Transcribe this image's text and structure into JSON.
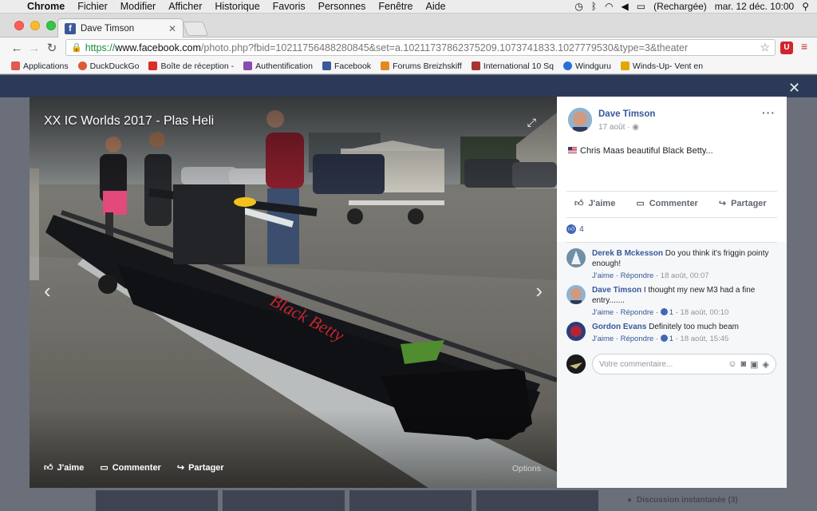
{
  "menubar": {
    "app": "Chrome",
    "items": [
      "Fichier",
      "Modifier",
      "Afficher",
      "Historique",
      "Favoris",
      "Personnes",
      "Fenêtre",
      "Aide"
    ],
    "battery": "(Rechargée)",
    "datetime": "mar. 12 déc.  10:00"
  },
  "browser": {
    "tab_title": "Dave Timson",
    "url_scheme": "https://",
    "url_host": "www.facebook.com",
    "url_path": "/photo.php?fbid=10211756488280845&set=a.10211737862375209.1073741833.1027779530&type=3&theater",
    "bookmarks": [
      {
        "label": "Applications",
        "color": "#d44"
      },
      {
        "label": "DuckDuckGo",
        "color": "#de5833"
      },
      {
        "label": "Boîte de réception -",
        "color": "#d93025"
      },
      {
        "label": "Authentification",
        "color": "#8a4baf"
      },
      {
        "label": "Facebook",
        "color": "#3b5998"
      },
      {
        "label": "Forums Breizhskiff",
        "color": "#e28a20"
      },
      {
        "label": "International 10 Sq",
        "color": "#a33"
      },
      {
        "label": "Windguru",
        "color": "#2a6fd6"
      },
      {
        "label": "Winds-Up- Vent en",
        "color": "#e0a800"
      }
    ]
  },
  "photo": {
    "title": "XX IC Worlds 2017 - Plas Heli",
    "actions": {
      "like": "J'aime",
      "comment": "Commenter",
      "share": "Partager"
    },
    "options": "Options"
  },
  "post": {
    "author": "Dave Timson",
    "date": "17 août",
    "caption": "Chris Maas beautiful Black Betty...",
    "actions": {
      "like": "J'aime",
      "comment": "Commenter",
      "share": "Partager"
    },
    "like_count": "4",
    "comments": [
      {
        "author": "Derek B Mckesson",
        "text": "Do you think it's friggin pointy enough!",
        "like": "J'aime",
        "reply": "Répondre",
        "likes": "",
        "time": "18 août, 00:07"
      },
      {
        "author": "Dave Timson",
        "text": "I thought my new M3 had a fine entry.......",
        "like": "J'aime",
        "reply": "Répondre",
        "likes": "1",
        "time": "18 août, 00:10"
      },
      {
        "author": "Gordon Evans",
        "text": "Definitely too much beam",
        "like": "J'aime",
        "reply": "Répondre",
        "likes": "1",
        "time": "18 août, 15:45"
      }
    ],
    "composer_placeholder": "Votre commentaire..."
  },
  "chat": {
    "label": "Discussion instantanée (3)"
  },
  "colors": {
    "facebook_blue": "#365899",
    "header": "#2d3a57",
    "like_blue": "#4267b2"
  }
}
